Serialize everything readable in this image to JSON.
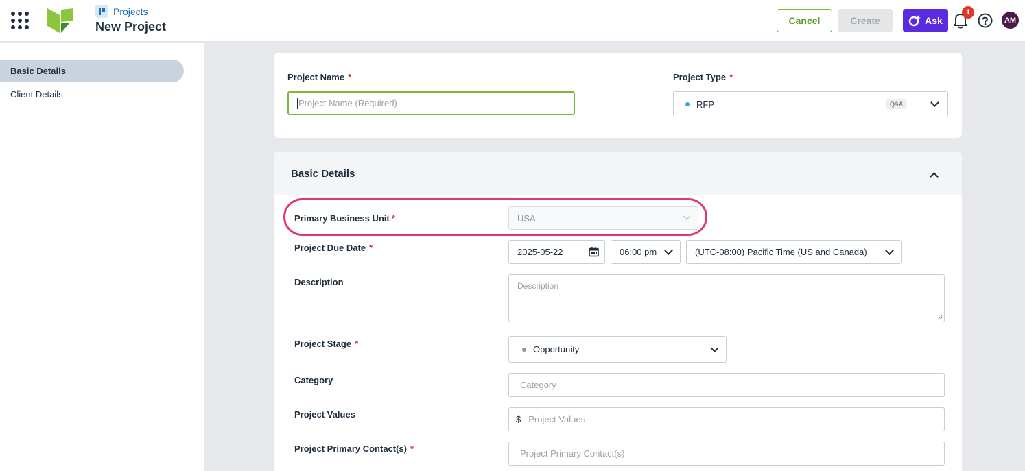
{
  "header": {
    "breadcrumb": "Projects",
    "title": "New Project",
    "cancel_label": "Cancel",
    "create_label": "Create",
    "ask_label": "Ask",
    "notification_count": "1",
    "avatar_initials": "AM"
  },
  "sidebar": {
    "items": [
      {
        "label": "Basic Details",
        "active": true
      },
      {
        "label": "Client Details",
        "active": false
      }
    ]
  },
  "top_form": {
    "project_name_label": "Project Name",
    "project_name_placeholder": "Project Name (Required)",
    "project_type_label": "Project Type",
    "project_type_value": "RFP",
    "project_type_tag": "Q&A"
  },
  "basic_details": {
    "title": "Basic Details",
    "primary_business_unit_label": "Primary Business Unit",
    "primary_business_unit_value": "USA",
    "due_date_label": "Project Due Date",
    "due_date_value": "2025-05-22",
    "due_time_value": "06:00 pm",
    "timezone_value": "(UTC-08:00) Pacific Time (US and Canada)",
    "description_label": "Description",
    "description_placeholder": "Description",
    "stage_label": "Project Stage",
    "stage_value": "Opportunity",
    "category_label": "Category",
    "category_placeholder": "Category",
    "values_label": "Project Values",
    "values_currency": "$",
    "values_placeholder": "Project Values",
    "contacts_label": "Project Primary Contact(s)",
    "contacts_placeholder": "Project Primary Contact(s)"
  },
  "colors": {
    "accent_green": "#7fb73a",
    "ask_purple": "#5b2be0",
    "highlight": "#e0396a",
    "required": "#d12d2d"
  }
}
